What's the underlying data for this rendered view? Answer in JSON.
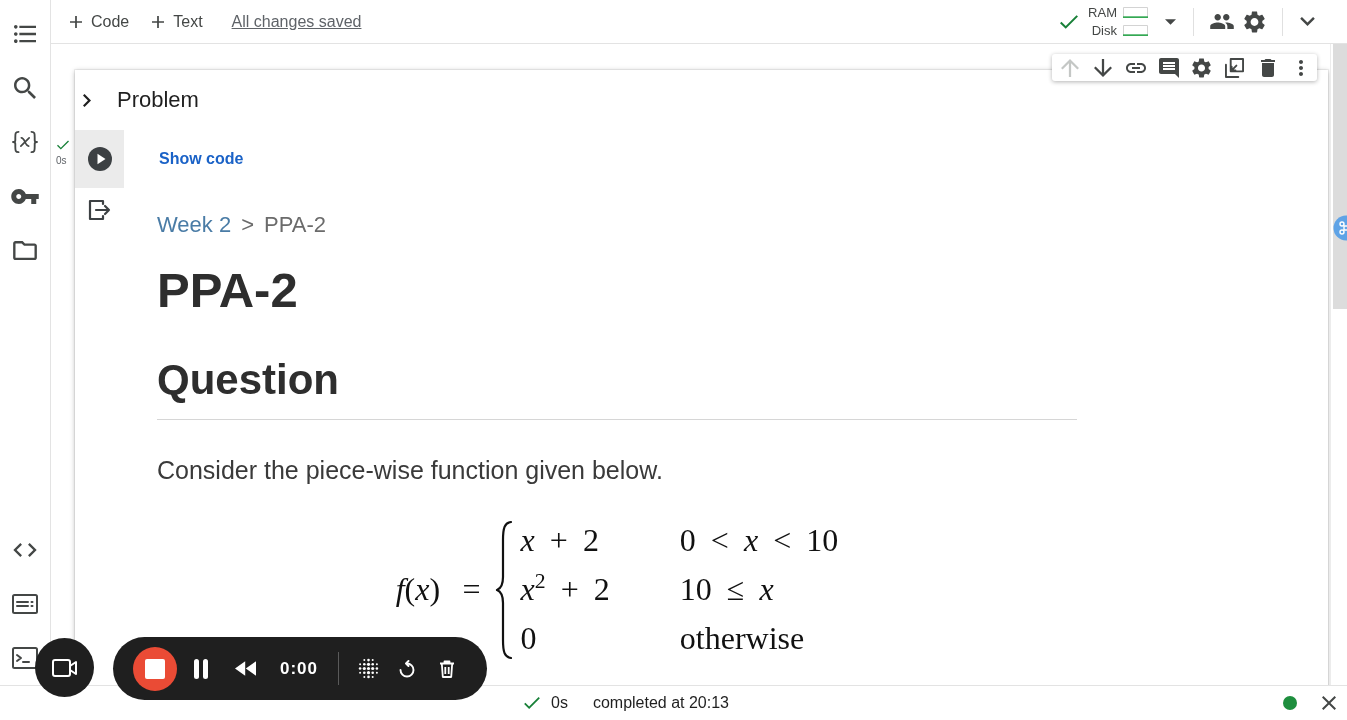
{
  "toolbar": {
    "insert_buttons": [
      {
        "label": "Code"
      },
      {
        "label": "Text"
      }
    ],
    "save_status": "All changes saved"
  },
  "runtime": {
    "connected": true,
    "meters": [
      {
        "label": "RAM"
      },
      {
        "label": "Disk"
      }
    ]
  },
  "notebook": {
    "cell": {
      "title": "Problem",
      "expanded": false,
      "selected": true,
      "toolbar": [
        {
          "disabled": true
        },
        {
          "disabled": false
        },
        {
          "disabled": false
        },
        {
          "disabled": false
        },
        {
          "disabled": false
        },
        {
          "disabled": false
        },
        {
          "disabled": false
        },
        {
          "disabled": false
        }
      ],
      "execution": {
        "done": true,
        "time": "0s"
      },
      "show_code_link": "Show code",
      "output": {
        "breadcrumb": [
          {
            "label": "Week 2",
            "link": true
          },
          {
            "label": "PPA-2",
            "link": false
          }
        ],
        "breadcrumb_separator": ">",
        "heading": "PPA-2",
        "subheading": "Question",
        "paragraph": "Consider the piece-wise function given below.",
        "formula": {
          "lhs": "*f*(*x*) =",
          "cases": [
            {
              "expr": "*x* + 2",
              "condition": "0 < *x* < 10"
            },
            {
              "expr": "*x*$^{2}$ + 2",
              "condition": "10 ≤ *x*"
            },
            {
              "expr": "0",
              "condition": "otherwise"
            }
          ]
        }
      }
    }
  },
  "recorder": {
    "time": "0:00"
  },
  "status_bar": {
    "done": true,
    "duration": "0s",
    "message": "completed at 20:13",
    "connected": true
  }
}
